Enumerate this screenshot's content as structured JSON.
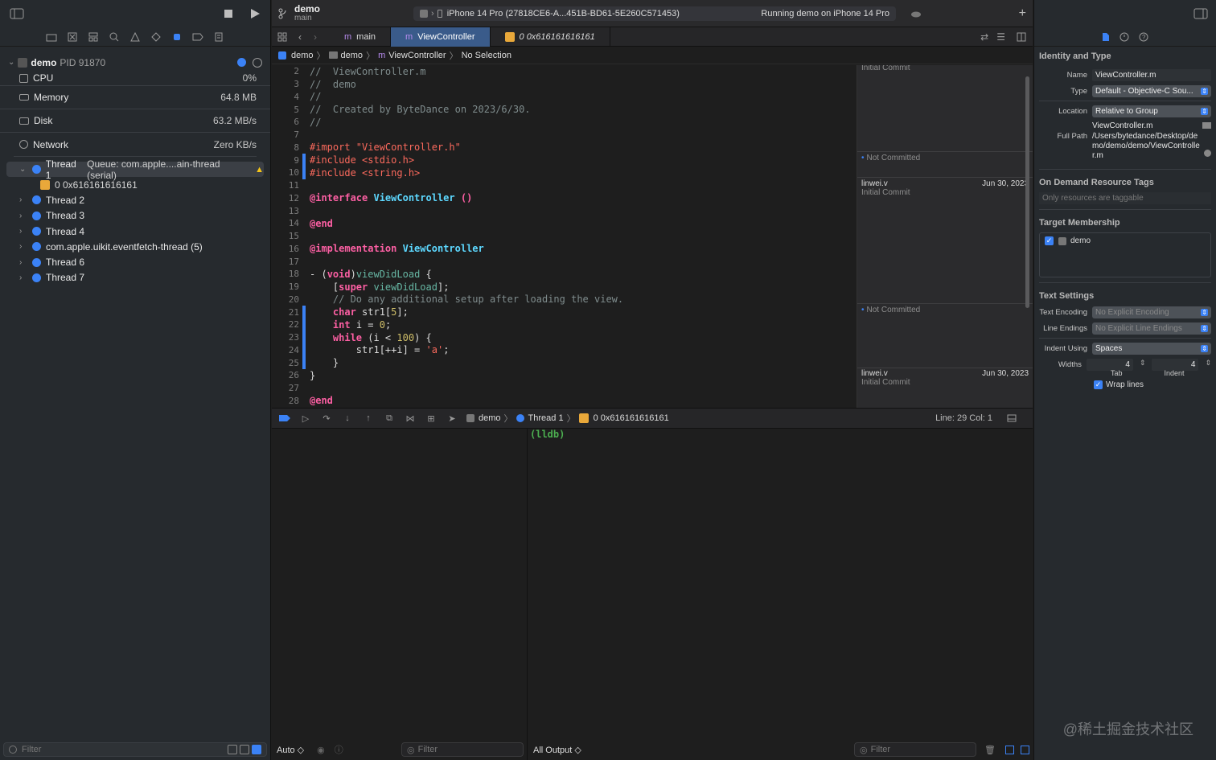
{
  "left": {
    "process": {
      "name": "demo",
      "pid": "PID 91870"
    },
    "gauges": [
      {
        "label": "CPU",
        "value": "0%",
        "icon": "cpu-icon"
      },
      {
        "label": "Memory",
        "value": "64.8 MB",
        "icon": "memory-icon"
      },
      {
        "label": "Disk",
        "value": "63.2 MB/s",
        "icon": "disk-icon"
      },
      {
        "label": "Network",
        "value": "Zero KB/s",
        "icon": "network-icon"
      }
    ],
    "thread1": {
      "label": "Thread 1",
      "queue": "Queue: com.apple....ain-thread (serial)"
    },
    "frame0": "0 0x616161616161",
    "threads": [
      "Thread 2",
      "Thread 3",
      "Thread 4",
      "com.apple.uikit.eventfetch-thread (5)",
      "Thread 6",
      "Thread 7"
    ],
    "filter_placeholder": "Filter"
  },
  "toolbar": {
    "project": "demo",
    "branch": "main",
    "device": "iPhone 14 Pro (27818CE6-A...451B-BD61-5E260C571453)",
    "status": "Running demo on iPhone 14 Pro"
  },
  "tabs": [
    {
      "label": "main",
      "prefix": "m"
    },
    {
      "label": "ViewController",
      "prefix": "m"
    },
    {
      "label": "0 0x616161616161",
      "prefix": ""
    }
  ],
  "jumpbar": [
    "demo",
    "demo",
    "ViewController",
    "No Selection"
  ],
  "code": [
    {
      "n": "2",
      "t": "//  ViewController.m",
      "c": "cm",
      "bar": false
    },
    {
      "n": "3",
      "t": "//  demo",
      "c": "cm",
      "bar": false
    },
    {
      "n": "4",
      "t": "//",
      "c": "cm",
      "bar": false
    },
    {
      "n": "5",
      "t": "//  Created by ByteDance on 2023/6/30.",
      "c": "cm",
      "bar": false
    },
    {
      "n": "6",
      "t": "//",
      "c": "cm",
      "bar": false
    },
    {
      "n": "7",
      "t": "",
      "c": "txt",
      "bar": false
    },
    {
      "n": "8",
      "t": "#import \"ViewController.h\"",
      "c": "pp",
      "bar": false
    },
    {
      "n": "9",
      "t": "#include <stdio.h>",
      "c": "pp",
      "bar": true
    },
    {
      "n": "10",
      "t": "#include <string.h>",
      "c": "pp",
      "bar": true
    },
    {
      "n": "11",
      "t": "",
      "c": "txt",
      "bar": false
    },
    {
      "n": "12",
      "t": "@interface ViewController ()",
      "c": "kw",
      "bar": false
    },
    {
      "n": "13",
      "t": "",
      "c": "txt",
      "bar": false
    },
    {
      "n": "14",
      "t": "@end",
      "c": "kw",
      "bar": false
    },
    {
      "n": "15",
      "t": "",
      "c": "txt",
      "bar": false
    },
    {
      "n": "16",
      "t": "@implementation ViewController",
      "c": "kw",
      "bar": false
    },
    {
      "n": "17",
      "t": "",
      "c": "txt",
      "bar": false
    },
    {
      "n": "18",
      "t": "- (void)viewDidLoad {",
      "c": "txt",
      "bar": false
    },
    {
      "n": "19",
      "t": "    [super viewDidLoad];",
      "c": "txt",
      "bar": false
    },
    {
      "n": "20",
      "t": "    // Do any additional setup after loading the view.",
      "c": "cm",
      "bar": false
    },
    {
      "n": "21",
      "t": "    char str1[5];",
      "c": "txt",
      "bar": true
    },
    {
      "n": "22",
      "t": "    int i = 0;",
      "c": "txt",
      "bar": true
    },
    {
      "n": "23",
      "t": "    while (i < 100) {",
      "c": "txt",
      "bar": true
    },
    {
      "n": "24",
      "t": "        str1[++i] = 'a';",
      "c": "txt",
      "bar": true
    },
    {
      "n": "25",
      "t": "    }",
      "c": "txt",
      "bar": true
    },
    {
      "n": "26",
      "t": "}",
      "c": "txt",
      "bar": false
    },
    {
      "n": "27",
      "t": "",
      "c": "txt",
      "bar": false
    },
    {
      "n": "28",
      "t": "@end",
      "c": "kw",
      "bar": false
    }
  ],
  "blame": [
    {
      "type": "commit",
      "who": "",
      "sub": "Initial Commit",
      "date": ""
    },
    {
      "type": "nc",
      "text": "Not Committed"
    },
    {
      "type": "commit",
      "who": "linwei.v",
      "sub": "Initial Commit",
      "date": "Jun 30, 2023"
    },
    {
      "type": "nc",
      "text": "Not Committed"
    },
    {
      "type": "commit",
      "who": "linwei.v",
      "sub": "Initial Commit",
      "date": "Jun 30, 2023"
    }
  ],
  "debugbar": {
    "crumbs": [
      "demo",
      "Thread 1",
      "0 0x616161616161"
    ],
    "line_col": "Line: 29  Col: 1"
  },
  "console": {
    "prompt": "(lldb)",
    "auto_label": "Auto ◇",
    "output_label": "All Output ◇",
    "filter_placeholder": "Filter"
  },
  "inspector": {
    "identity_title": "Identity and Type",
    "name_k": "Name",
    "name_v": "ViewController.m",
    "type_k": "Type",
    "type_v": "Default - Objective-C Sou...",
    "location_k": "Location",
    "location_v": "Relative to Group",
    "location_file": "ViewController.m",
    "fullpath_k": "Full Path",
    "fullpath_v": "/Users/bytedance/Desktop/demo/demo/demo/ViewController.m",
    "odr_title": "On Demand Resource Tags",
    "odr_placeholder": "Only resources are taggable",
    "target_title": "Target Membership",
    "target_item": "demo",
    "text_title": "Text Settings",
    "enc_k": "Text Encoding",
    "enc_v": "No Explicit Encoding",
    "le_k": "Line Endings",
    "le_v": "No Explicit Line Endings",
    "indent_k": "Indent Using",
    "indent_v": "Spaces",
    "widths_k": "Widths",
    "tab_val": "4",
    "indent_val": "4",
    "tab_lbl": "Tab",
    "indent_lbl": "Indent",
    "wrap": "Wrap lines"
  },
  "watermark": "@稀土掘金技术社区"
}
